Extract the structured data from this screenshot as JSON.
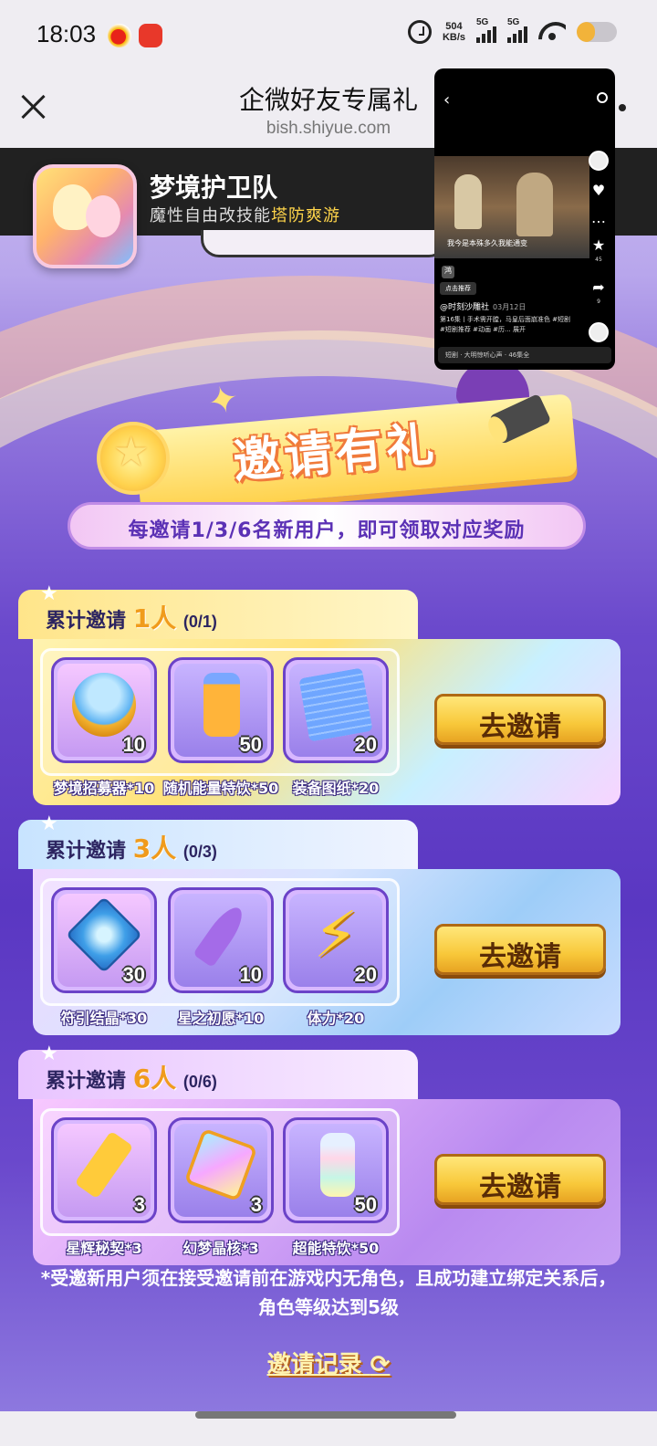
{
  "status_bar": {
    "time": "18:03",
    "net_speed_value": "504",
    "net_speed_unit": "KB/s",
    "sim1": "5G",
    "sim2": "5G",
    "battery_level": 0.45,
    "icons": [
      "weibo-icon",
      "app-icon",
      "alarm-icon",
      "signal-icon",
      "wifi-icon",
      "battery-icon"
    ]
  },
  "header": {
    "title": "企微好友专属礼",
    "url": "bish.shiyue.com"
  },
  "game": {
    "name": "梦境护卫队",
    "slogan_prefix": "魔性自由改技能",
    "slogan_highlight": "塔防爽游"
  },
  "event": {
    "title": "邀请有礼",
    "subtitle": "每邀请1/3/6名新用户，即可领取对应奖励"
  },
  "tiers": [
    {
      "label": "累计邀请",
      "count": "1人",
      "progress": "(0/1)",
      "button": "去邀请",
      "rewards": [
        {
          "name": "梦境招募器*10",
          "count": "10",
          "icon": "recruiter-icon"
        },
        {
          "name": "随机能量特饮*50",
          "count": "50",
          "icon": "energy-drink-icon"
        },
        {
          "name": "装备图纸*20",
          "count": "20",
          "icon": "blueprint-icon"
        }
      ]
    },
    {
      "label": "累计邀请",
      "count": "3人",
      "progress": "(0/3)",
      "button": "去邀请",
      "rewards": [
        {
          "name": "符引结晶*30",
          "count": "30",
          "icon": "rune-crystal-icon"
        },
        {
          "name": "星之初愿*10",
          "count": "10",
          "icon": "star-key-icon"
        },
        {
          "name": "体力*20",
          "count": "20",
          "icon": "stamina-bolt-icon"
        }
      ]
    },
    {
      "label": "累计邀请",
      "count": "6人",
      "progress": "(0/6)",
      "button": "去邀请",
      "rewards": [
        {
          "name": "星辉秘契*3",
          "count": "3",
          "icon": "starlight-key-icon"
        },
        {
          "name": "幻梦晶核*3",
          "count": "3",
          "icon": "dream-core-icon"
        },
        {
          "name": "超能特饮*50",
          "count": "50",
          "icon": "super-drink-icon"
        }
      ]
    }
  ],
  "footnote": "*受邀新用户须在接受邀请前在游戏内无角色，且成功建立绑定关系后，角色等级达到5级",
  "record_link": "邀请记录",
  "floating_video": {
    "caption": "我今是本殊多久我能通变",
    "tag": "鸿",
    "recommend": "点击推荐",
    "author": "@时刻沙雕社",
    "date": "03月12日",
    "desc": "第16集丨手术需开膛，马皇后面崩准色 #短剧 #短剧推荐 #动画 #历... 展开",
    "likes": "45",
    "shares": "9",
    "bottom": "短剧 · 大明惊听心声 · 46集全"
  }
}
